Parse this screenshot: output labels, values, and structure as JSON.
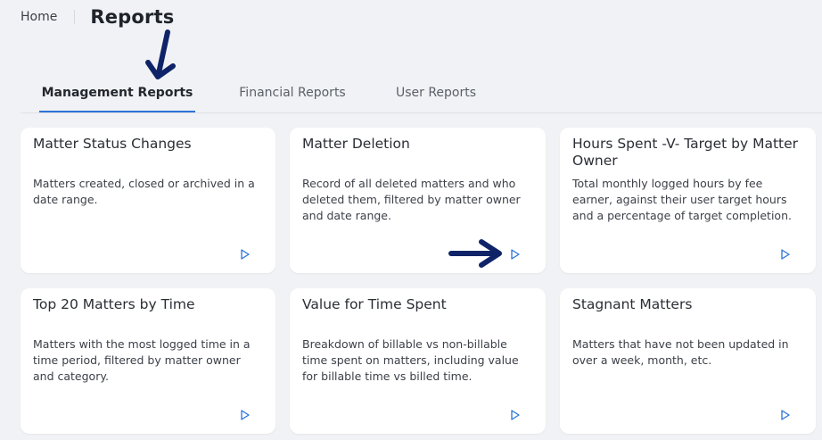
{
  "breadcrumb": {
    "home": "Home",
    "title": "Reports"
  },
  "tabs": [
    {
      "label": "Management Reports",
      "active": true
    },
    {
      "label": "Financial Reports",
      "active": false
    },
    {
      "label": "User Reports",
      "active": false
    }
  ],
  "cards": [
    {
      "title": "Matter Status Changes",
      "description": "Matters created, closed or archived in a date range."
    },
    {
      "title": "Matter Deletion",
      "description": "Record of all deleted matters and who deleted them, filtered by matter owner and date range."
    },
    {
      "title": "Hours Spent -V- Target by Matter Owner",
      "description": "Total monthly logged hours by fee earner, against their user target hours and a percentage of target completion."
    },
    {
      "title": "Top 20 Matters by Time",
      "description": "Matters with the most logged time in a time period, filtered by matter owner and category."
    },
    {
      "title": "Value for Time Spent",
      "description": "Breakdown of billable vs non-billable time spent on matters, including value for billable time vs billed time."
    },
    {
      "title": "Stagnant Matters",
      "description": "Matters that have not been updated in over a week, month, etc."
    }
  ],
  "colors": {
    "accent": "#2b74d9",
    "annotation_arrow": "#0f2468",
    "background": "#f1f2f5"
  },
  "icons": {
    "run_report": "play-icon",
    "annotation": "arrow-icon"
  }
}
